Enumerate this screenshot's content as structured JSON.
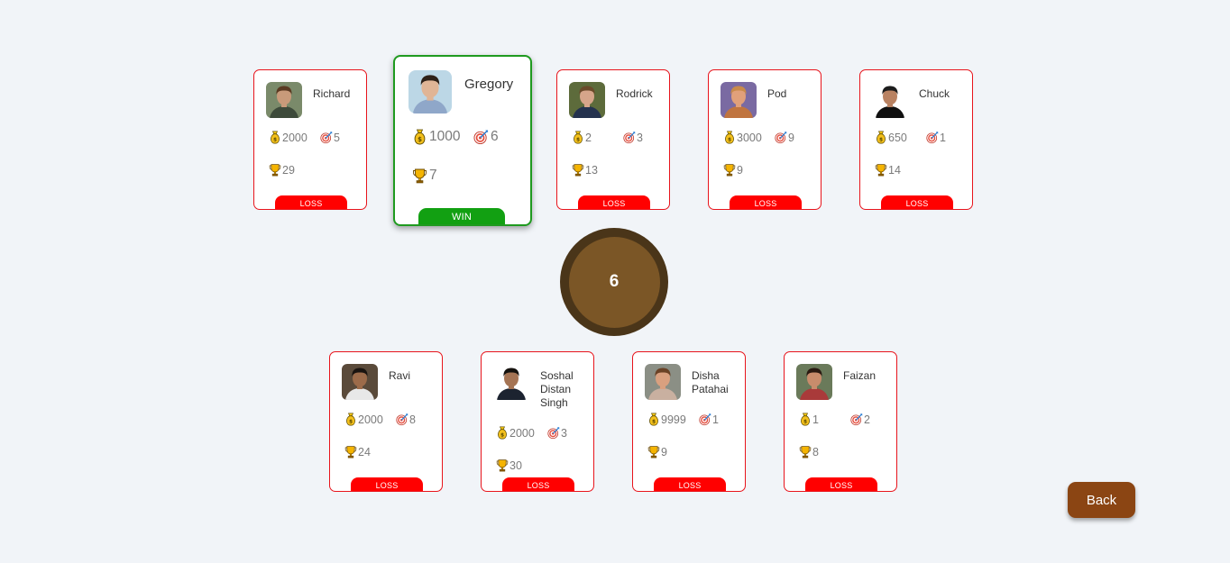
{
  "players": [
    {
      "name": "Richard",
      "coins": "2000",
      "targets": "5",
      "trophies": "29",
      "result": "LOSS",
      "skin": "#c89a7a",
      "hair": "#5a3a22",
      "bg": "#7a8a6a",
      "shirt": "#3d4a3a"
    },
    {
      "name": "Gregory",
      "coins": "1000",
      "targets": "6",
      "trophies": "7",
      "result": "WIN",
      "skin": "#e0b596",
      "hair": "#2e2118",
      "bg": "#bcd7e6",
      "shirt": "#8fa7c9"
    },
    {
      "name": "Rodrick",
      "coins": "2",
      "targets": "3",
      "trophies": "13",
      "result": "LOSS",
      "skin": "#d6a58a",
      "hair": "#6b4a2a",
      "bg": "#5d6b3b",
      "shirt": "#24324e"
    },
    {
      "name": "Pod",
      "coins": "3000",
      "targets": "9",
      "trophies": "9",
      "result": "LOSS",
      "skin": "#e1a07a",
      "hair": "#c98a4a",
      "bg": "#7a6aa2",
      "shirt": "#c0743f"
    },
    {
      "name": "Chuck",
      "coins": "650",
      "targets": "1",
      "trophies": "14",
      "result": "LOSS",
      "skin": "#b98262",
      "hair": "#1d1d1d",
      "bg": "#ffffff",
      "shirt": "#101010"
    },
    {
      "name": "Ravi",
      "coins": "2000",
      "targets": "8",
      "trophies": "24",
      "result": "LOSS",
      "skin": "#9c6b4a",
      "hair": "#1a1410",
      "bg": "#5a4a3a",
      "shirt": "#e8e8e8"
    },
    {
      "name": "Soshal Distan Singh",
      "coins": "2000",
      "targets": "3",
      "trophies": "30",
      "result": "LOSS",
      "skin": "#a57454",
      "hair": "#15120e",
      "bg": "#ffffff",
      "shirt": "#1c2330"
    },
    {
      "name": "Disha Patahai",
      "coins": "9999",
      "targets": "1",
      "trophies": "9",
      "result": "LOSS",
      "skin": "#d9a07f",
      "hair": "#6a4226",
      "bg": "#8b8f85",
      "shirt": "#c9b0a0"
    },
    {
      "name": "Faizan",
      "coins": "1",
      "targets": "2",
      "trophies": "8",
      "result": "LOSS",
      "skin": "#c88c6c",
      "hair": "#2a1a12",
      "bg": "#6a7a5a",
      "shirt": "#a93a3a"
    }
  ],
  "counter": {
    "value": "6"
  },
  "back_button": {
    "label": "Back"
  },
  "colors": {
    "loss": "#ff0000",
    "win": "#12a012",
    "counter_outer": "#4a3519",
    "counter_inner": "#7b5626",
    "back": "#8b4513"
  },
  "icons": {
    "coins": "money-bag-icon",
    "targets": "target-icon",
    "trophies": "trophy-icon"
  }
}
